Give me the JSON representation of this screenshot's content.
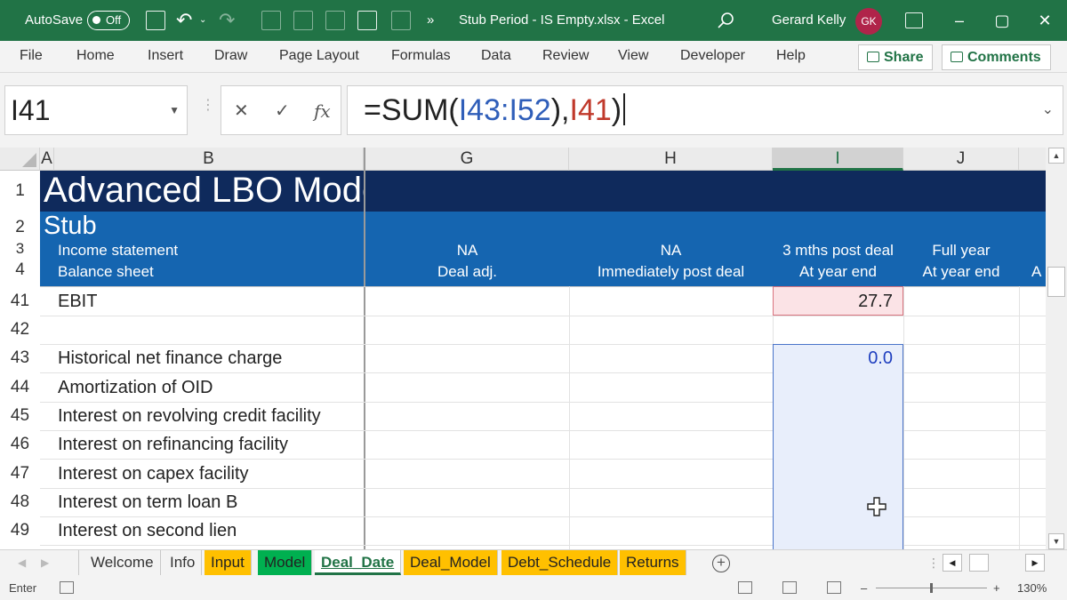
{
  "titlebar": {
    "autosave_label": "AutoSave",
    "autosave_state": "Off",
    "more": "»",
    "document_title": "Stub Period - IS Empty.xlsx  -  Excel",
    "user_name": "Gerard Kelly",
    "user_initials": "GK",
    "search_icon": "search-icon",
    "minimize": "–",
    "maximize": "▢",
    "close": "✕"
  },
  "ribbon": {
    "tabs": [
      "File",
      "Home",
      "Insert",
      "Draw",
      "Page Layout",
      "Formulas",
      "Data",
      "Review",
      "View",
      "Developer",
      "Help"
    ],
    "share_label": "Share",
    "comments_label": "Comments"
  },
  "formula_bar": {
    "name_box": "I41",
    "cancel": "✕",
    "enter": "✓",
    "fx": "fx",
    "formula_parts": {
      "p1": "=SUM(",
      "ref1": "I43:I52",
      "p2": "),",
      "ref2": "I41",
      "p3": ")"
    }
  },
  "columns": {
    "a": "A",
    "b": "B",
    "g": "G",
    "h": "H",
    "i": "I",
    "j": "J"
  },
  "header_rows": {
    "row1": {
      "num": "1",
      "title": "Advanced LBO Model"
    },
    "row2": {
      "num": "2",
      "title": "Stub"
    },
    "row3": {
      "num": "3",
      "label": "Income statement",
      "g": "NA",
      "h": "NA",
      "i": "3 mths post deal",
      "j": "Full year"
    },
    "row4": {
      "num": "4",
      "label": "Balance sheet",
      "g": "Deal adj.",
      "h": "Immediately post deal",
      "i": "At year end",
      "j": "At year end",
      "k": "A"
    }
  },
  "rows": [
    {
      "num": "41",
      "label": "EBIT",
      "i_value": "27.7"
    },
    {
      "num": "42",
      "label": "",
      "i_value": ""
    },
    {
      "num": "43",
      "label": "Historical net finance charge",
      "i_value": "0.0"
    },
    {
      "num": "44",
      "label": "Amortization of OID",
      "i_value": ""
    },
    {
      "num": "45",
      "label": "Interest on revolving credit facility",
      "i_value": ""
    },
    {
      "num": "46",
      "label": "Interest on refinancing facility",
      "i_value": ""
    },
    {
      "num": "47",
      "label": "Interest on capex facility",
      "i_value": ""
    },
    {
      "num": "48",
      "label": "Interest on term loan B",
      "i_value": ""
    },
    {
      "num": "49",
      "label": "Interest on second lien",
      "i_value": ""
    }
  ],
  "sheet_tabs": [
    "Welcome",
    "Info",
    "Input",
    "Model",
    "Deal_Date",
    "Deal_Model",
    "Debt_Schedule",
    "Returns"
  ],
  "active_sheet": "Deal_Date",
  "status": {
    "mode": "Enter",
    "zoom": "130%"
  },
  "colors": {
    "excel_green": "#217346",
    "title_band": "#0f2a5c",
    "stub_band": "#1565b0",
    "selected_cell_fill": "#fbe3e6",
    "selected_cell_border": "#d9747f",
    "range_fill": "#e8eefb",
    "range_border": "#4a74c9",
    "tab_orange": "#ffc000",
    "tab_green": "#00b050"
  }
}
